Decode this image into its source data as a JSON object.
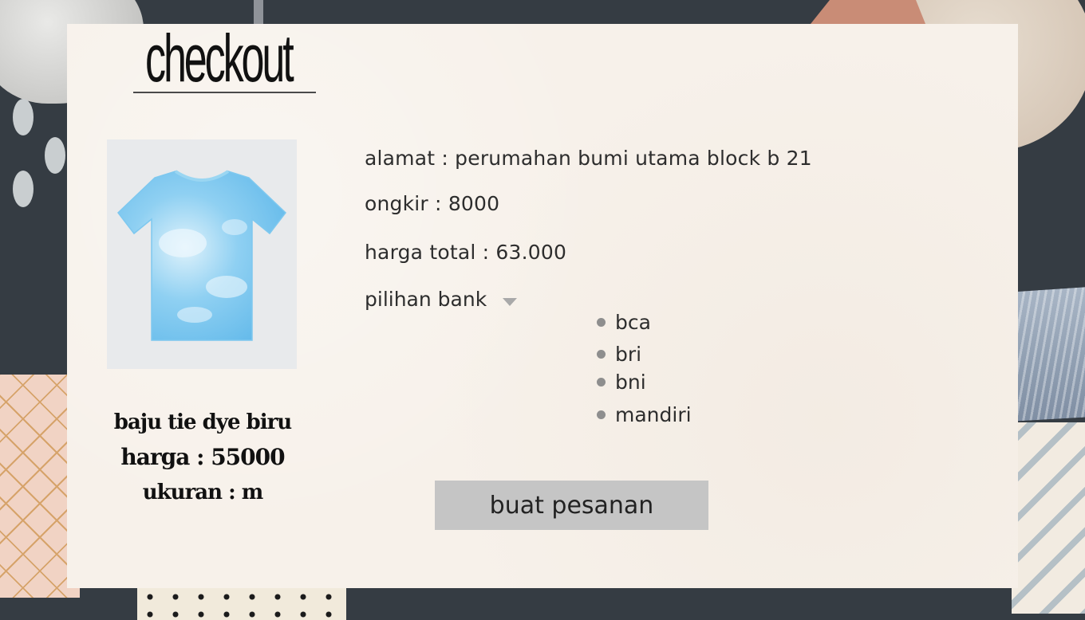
{
  "page": {
    "title": "checkout"
  },
  "product": {
    "name": "baju tie dye biru",
    "price_text": "harga : 55000",
    "size_text": "ukuran : m",
    "image": {
      "subject": "tshirt-icon",
      "color": "#7ec8ef"
    }
  },
  "order": {
    "address_text": "alamat : perumahan bumi utama block b 21",
    "shipping_text": "ongkir : 8000",
    "total_text": "harga total : 63.000"
  },
  "bank": {
    "label": "pilihan bank",
    "options": [
      "bca",
      "bri",
      "bni",
      "mandiri"
    ]
  },
  "actions": {
    "order_button": "buat pesanan"
  },
  "colors": {
    "background": "#353c43",
    "card": "#f7f1ea",
    "button": "#c5c5c5",
    "text": "#2d2d2d"
  }
}
